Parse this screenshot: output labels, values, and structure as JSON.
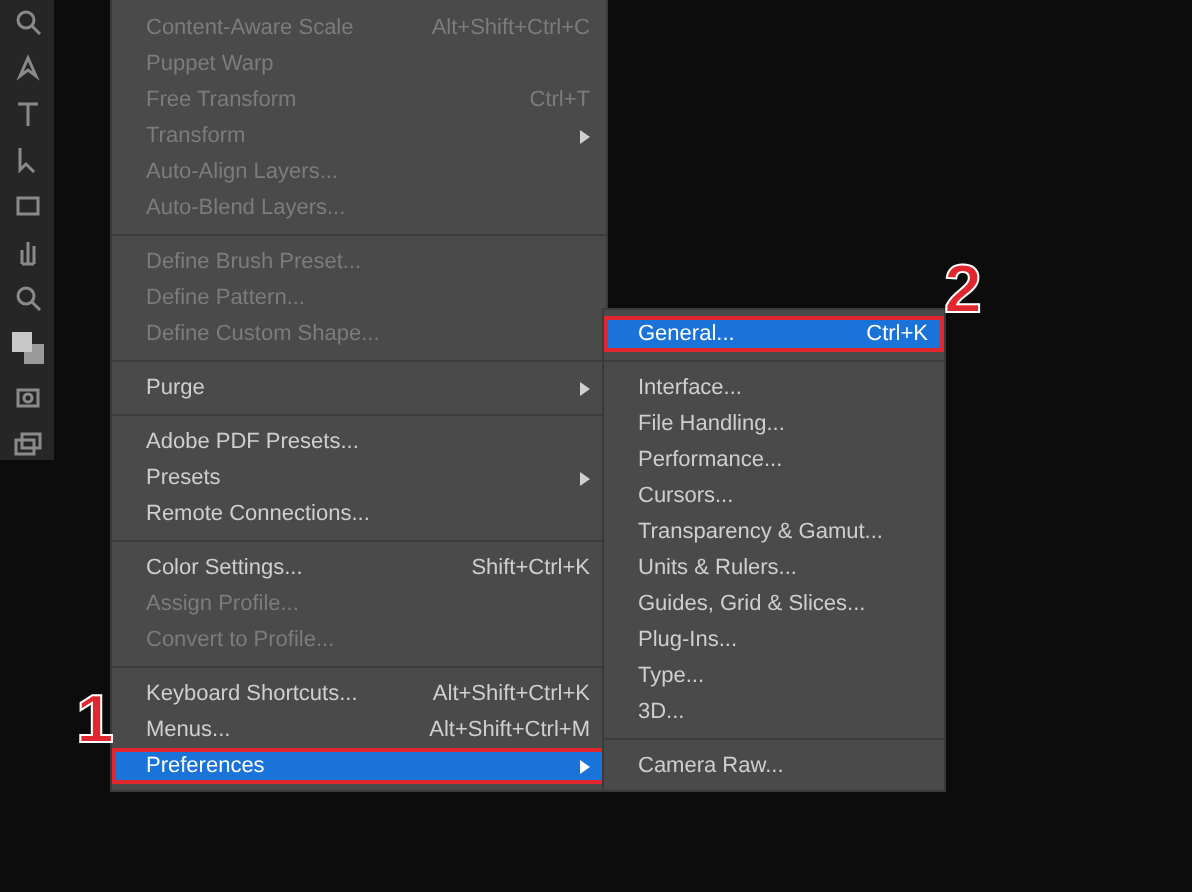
{
  "menu": {
    "sections": [
      {
        "items": [
          {
            "label": "Content-Aware Scale",
            "shortcut": "Alt+Shift+Ctrl+C",
            "disabled": true,
            "submenu": false,
            "selected": false
          },
          {
            "label": "Puppet Warp",
            "disabled": true,
            "submenu": false,
            "selected": false
          },
          {
            "label": "Free Transform",
            "shortcut": "Ctrl+T",
            "disabled": true,
            "submenu": false,
            "selected": false
          },
          {
            "label": "Transform",
            "disabled": true,
            "submenu": true,
            "selected": false
          },
          {
            "label": "Auto-Align Layers...",
            "disabled": true,
            "submenu": false,
            "selected": false
          },
          {
            "label": "Auto-Blend Layers...",
            "disabled": true,
            "submenu": false,
            "selected": false
          }
        ]
      },
      {
        "items": [
          {
            "label": "Define Brush Preset...",
            "disabled": true,
            "submenu": false,
            "selected": false
          },
          {
            "label": "Define Pattern...",
            "disabled": true,
            "submenu": false,
            "selected": false
          },
          {
            "label": "Define Custom Shape...",
            "disabled": true,
            "submenu": false,
            "selected": false
          }
        ]
      },
      {
        "items": [
          {
            "label": "Purge",
            "disabled": false,
            "submenu": true,
            "selected": false
          }
        ]
      },
      {
        "items": [
          {
            "label": "Adobe PDF Presets...",
            "disabled": false,
            "submenu": false,
            "selected": false
          },
          {
            "label": "Presets",
            "disabled": false,
            "submenu": true,
            "selected": false
          },
          {
            "label": "Remote Connections...",
            "disabled": false,
            "submenu": false,
            "selected": false
          }
        ]
      },
      {
        "items": [
          {
            "label": "Color Settings...",
            "shortcut": "Shift+Ctrl+K",
            "disabled": false,
            "submenu": false,
            "selected": false
          },
          {
            "label": "Assign Profile...",
            "disabled": true,
            "submenu": false,
            "selected": false
          },
          {
            "label": "Convert to Profile...",
            "disabled": true,
            "submenu": false,
            "selected": false
          }
        ]
      },
      {
        "items": [
          {
            "label": "Keyboard Shortcuts...",
            "shortcut": "Alt+Shift+Ctrl+K",
            "disabled": false,
            "submenu": false,
            "selected": false
          },
          {
            "label": "Menus...",
            "shortcut": "Alt+Shift+Ctrl+M",
            "disabled": false,
            "submenu": false,
            "selected": false
          },
          {
            "label": "Preferences",
            "disabled": false,
            "submenu": true,
            "selected": true
          }
        ]
      }
    ]
  },
  "submenu": {
    "sections": [
      {
        "items": [
          {
            "label": "General...",
            "shortcut": "Ctrl+K",
            "selected": true
          }
        ]
      },
      {
        "items": [
          {
            "label": "Interface...",
            "selected": false
          },
          {
            "label": "File Handling...",
            "selected": false
          },
          {
            "label": "Performance...",
            "selected": false
          },
          {
            "label": "Cursors...",
            "selected": false
          },
          {
            "label": "Transparency & Gamut...",
            "selected": false
          },
          {
            "label": "Units & Rulers...",
            "selected": false
          },
          {
            "label": "Guides, Grid & Slices...",
            "selected": false
          },
          {
            "label": "Plug-Ins...",
            "selected": false
          },
          {
            "label": "Type...",
            "selected": false
          },
          {
            "label": "3D...",
            "selected": false
          }
        ]
      },
      {
        "items": [
          {
            "label": "Camera Raw...",
            "selected": false
          }
        ]
      }
    ]
  },
  "annotations": [
    {
      "kind": "step",
      "text": "1"
    },
    {
      "kind": "step",
      "text": "2"
    }
  ]
}
